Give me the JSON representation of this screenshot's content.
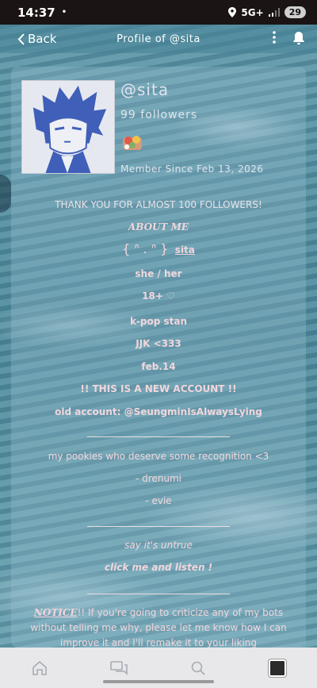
{
  "status_bar": {
    "time": "14:37",
    "dot": "•",
    "network": "5G+",
    "battery": "29"
  },
  "header": {
    "back_label": "Back",
    "title": "Profile of @sita"
  },
  "profile": {
    "username": "@sita",
    "followers": "99 followers",
    "member_since": "Member Since Feb 13, 2026"
  },
  "bio": {
    "thanks": "THANK YOU FOR ALMOST 100 FOLLOWERS!",
    "about_heading": "ABOUT ME",
    "kaomoji": "{ ᐢ . ᐢ }",
    "name": "sita",
    "pronouns": "she / her",
    "age": "18+ ♡",
    "stan": "k-pop stan",
    "bias": "JJK <333",
    "birthday": "feb.14",
    "new_account": "!! THIS IS A NEW ACCOUNT !!",
    "old_account": "old account: @SeungminIsAlwaysLying",
    "pookies": "my pookies who deserve some recognition <3",
    "pookie_1": "- drenumi",
    "pookie_2": "- evie",
    "song_1": "say it's untrue",
    "song_2": "click me and listen !",
    "notice_label": "NOTICE",
    "notice_text_1": "!! If you're going to criticize any of my bots",
    "notice_text_2": "without telling me why, please let me know how I can",
    "notice_text_3": "improve it and I'll remake it to your liking"
  },
  "icons": {
    "back": "chevron-left-icon",
    "menu": "kebab-icon",
    "bell": "bell-icon",
    "home": "home-icon",
    "chat": "chat-icon",
    "search": "search-icon"
  },
  "colors": {
    "bio_text": "#f1d6dc",
    "profile_text": "#dfe3ec",
    "status_bar": "#1b1414"
  }
}
